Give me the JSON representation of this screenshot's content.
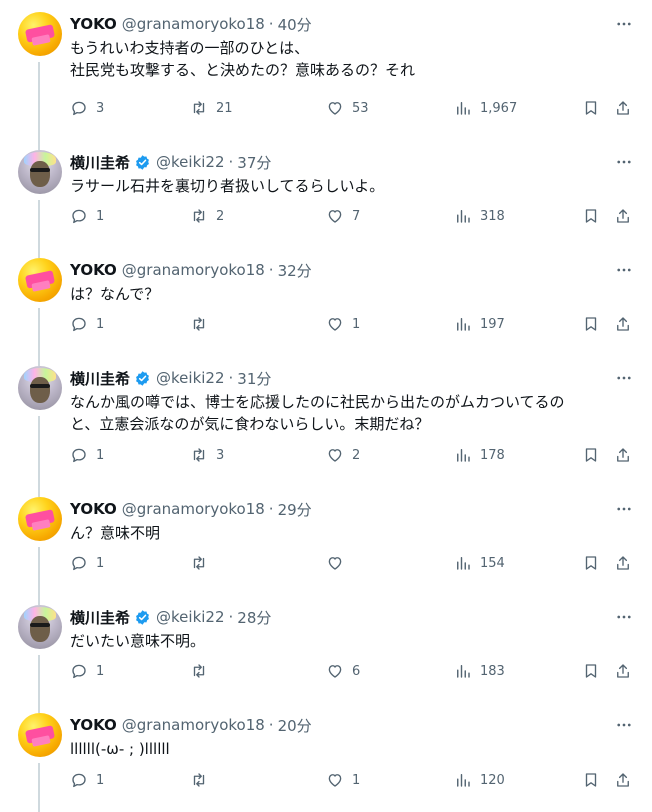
{
  "tweets": [
    {
      "user": "yoko",
      "name": "YOKO",
      "handle": "@granamoryoko18",
      "time": "40分",
      "text": [
        "もうれいわ支持者の一部のひとは、",
        "社民党も攻撃する、と決めたの？意味あるの？それ"
      ],
      "replies": "3",
      "retweets": "21",
      "likes": "53",
      "views": "1,967",
      "verified": false
    },
    {
      "user": "keiki",
      "name": "横川圭希",
      "handle": "@keiki22",
      "time": "37分",
      "text": [
        "ラサール石井を裏切り者扱いしてるらしいよ。"
      ],
      "replies": "1",
      "retweets": "2",
      "likes": "7",
      "views": "318",
      "verified": true
    },
    {
      "user": "yoko",
      "name": "YOKO",
      "handle": "@granamoryoko18",
      "time": "32分",
      "text": [
        "は？なんで？"
      ],
      "replies": "1",
      "retweets": "",
      "likes": "1",
      "views": "197",
      "verified": false
    },
    {
      "user": "keiki",
      "name": "横川圭希",
      "handle": "@keiki22",
      "time": "31分",
      "text": [
        "なんか風の噂では、博士を応援したのに社民から出たのがムカついてるの",
        "と、立憲会派なのが気に食わないらしい。末期だね？"
      ],
      "replies": "1",
      "retweets": "3",
      "likes": "2",
      "views": "178",
      "verified": true
    },
    {
      "user": "yoko",
      "name": "YOKO",
      "handle": "@granamoryoko18",
      "time": "29分",
      "text": [
        "ん？意味不明"
      ],
      "replies": "1",
      "retweets": "",
      "likes": "",
      "views": "154",
      "verified": false
    },
    {
      "user": "keiki",
      "name": "横川圭希",
      "handle": "@keiki22",
      "time": "28分",
      "text": [
        "だいたい意味不明。"
      ],
      "replies": "1",
      "retweets": "",
      "likes": "6",
      "views": "183",
      "verified": true
    },
    {
      "user": "yoko",
      "name": "YOKO",
      "handle": "@granamoryoko18",
      "time": "20分",
      "text": [
        "llllll(-ω- ; )llllll"
      ],
      "replies": "1",
      "retweets": "",
      "likes": "1",
      "views": "120",
      "verified": false
    }
  ],
  "separator": "·",
  "icons": {
    "more": "more-horizontal-icon",
    "reply": "reply-icon",
    "retweet": "retweet-icon",
    "like": "heart-icon",
    "views": "analytics-icon",
    "bookmark": "bookmark-icon",
    "share": "share-icon",
    "verified": "verified-badge-icon"
  },
  "colors": {
    "verified": "#1d9bf0",
    "secondary_text": "#536471",
    "thread_line": "#cfd9de"
  }
}
